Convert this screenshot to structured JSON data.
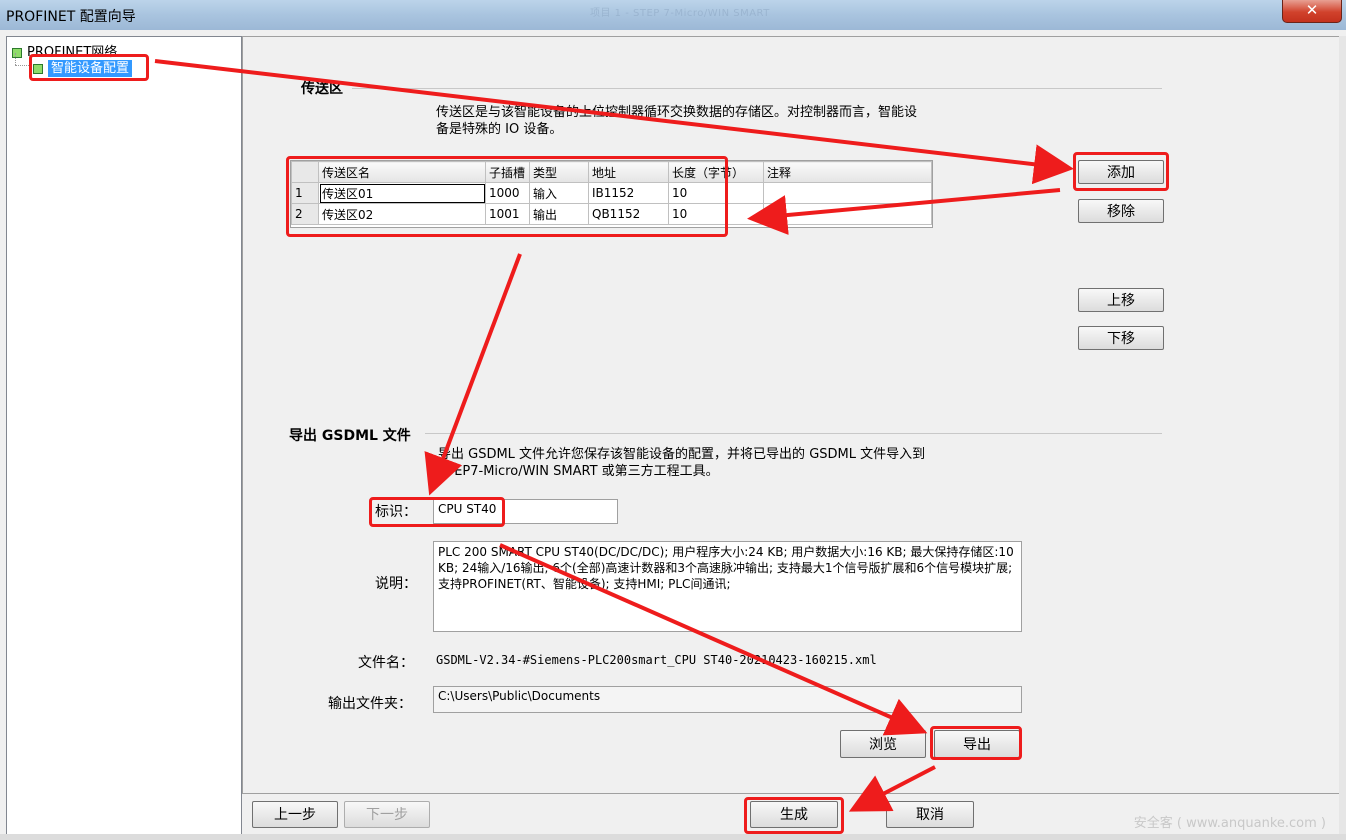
{
  "window": {
    "title": "PROFINET 配置向导",
    "ghost_title": "项目 1 - STEP 7-Micro/WIN SMART",
    "close_label": "✕"
  },
  "tree": {
    "root": "PROFINET网络",
    "child": "智能设备配置"
  },
  "transfer": {
    "title": "传送区",
    "desc_line1": "传送区是与该智能设备的上位控制器循环交换数据的存储区。对控制器而言，智能设",
    "desc_line2": "备是特殊的 IO 设备。",
    "headers": [
      "传送区名",
      "子插槽",
      "类型",
      "地址",
      "长度（字节）",
      "注释"
    ],
    "rows": [
      {
        "no": "1",
        "name": "传送区01",
        "slot": "1000",
        "type": "输入",
        "addr": "IB1152",
        "len": "10",
        "note": ""
      },
      {
        "no": "2",
        "name": "传送区02",
        "slot": "1001",
        "type": "输出",
        "addr": "QB1152",
        "len": "10",
        "note": ""
      }
    ],
    "buttons": {
      "add": "添加",
      "remove": "移除",
      "up": "上移",
      "down": "下移"
    }
  },
  "gsdml": {
    "title": "导出 GSDML 文件",
    "desc_line1": "导出 GSDML 文件允许您保存该智能设备的配置，并将已导出的 GSDML 文件导入到",
    "desc_line2": "STEP7-Micro/WIN SMART 或第三方工程工具。",
    "id_label": "标识：",
    "id_value": "CPU ST40",
    "desc_label": "说明：",
    "desc_value": "PLC 200 SMART CPU ST40(DC/DC/DC); 用户程序大小:24 KB; 用户数据大小:16 KB; 最大保持存储区:10 KB; 24输入/16输出; 6个(全部)高速计数器和3个高速脉冲输出; 支持最大1个信号版扩展和6个信号模块扩展;支持PROFINET(RT、智能设备); 支持HMI; PLC间通讯;",
    "file_label": "文件名：",
    "file_value": "GSDML-V2.34-#Siemens-PLC200smart_CPU ST40-20210423-160215.xml",
    "folder_label": "输出文件夹：",
    "folder_value": "C:\\Users\\Public\\Documents",
    "browse": "浏览",
    "export": "导出"
  },
  "footer": {
    "prev": "上一步",
    "next": "下一步",
    "generate": "生成",
    "cancel": "取消"
  },
  "watermark": "安全客 ( www.anquanke.com )",
  "colors": {
    "highlight": "#ee1c1c",
    "selection": "#3399ff"
  }
}
